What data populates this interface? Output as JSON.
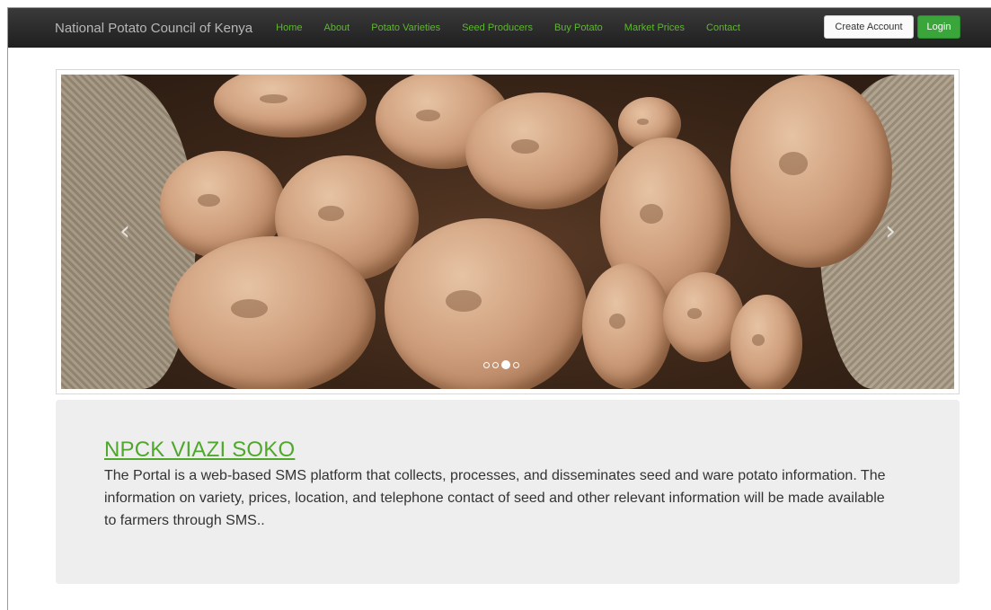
{
  "navbar": {
    "brand": "National Potato Council of Kenya",
    "links": [
      {
        "label": "Home"
      },
      {
        "label": "About"
      },
      {
        "label": "Potato Varieties"
      },
      {
        "label": "Seed Producers"
      },
      {
        "label": "Buy Potato"
      },
      {
        "label": "Market Prices"
      },
      {
        "label": "Contact"
      }
    ],
    "create_account_label": "Create Account",
    "login_label": "Login"
  },
  "carousel": {
    "image_subject": "potatoes in burlap sack",
    "prev_icon": "chevron-left-icon",
    "next_icon": "chevron-right-icon",
    "indicator_count": 4,
    "active_indicator": 3
  },
  "info": {
    "title": "NPCK VIAZI SOKO",
    "description": "The Portal is a web-based SMS platform that collects, processes, and disseminates seed and ware potato information. The information on variety, prices, location, and telephone contact of seed and other relevant information will be made available to farmers through SMS.."
  },
  "colors": {
    "nav_link": "#5cb82e",
    "login_button": "#3aa53a",
    "title_link": "#4fa82b",
    "info_background": "#eeeeee"
  }
}
